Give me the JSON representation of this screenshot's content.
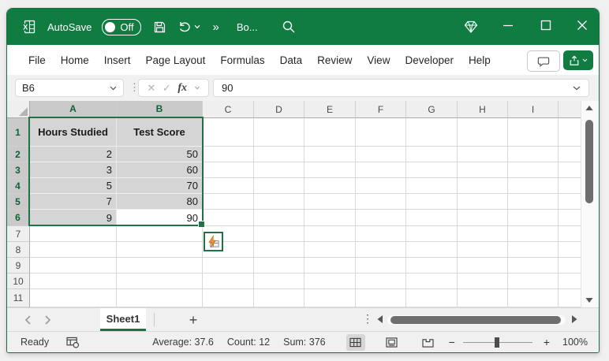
{
  "titlebar": {
    "autosave_label": "AutoSave",
    "autosave_state": "Off",
    "overflow_glyph": "»",
    "doc_name": "Bo..."
  },
  "menubar": {
    "items": [
      "File",
      "Home",
      "Insert",
      "Page Layout",
      "Formulas",
      "Data",
      "Review",
      "View",
      "Developer",
      "Help"
    ]
  },
  "formula_bar": {
    "name_box_value": "B6",
    "cancel_glyph": "✕",
    "enter_glyph": "✓",
    "fx_label": "fx",
    "input_value": "90"
  },
  "grid": {
    "column_labels": [
      "A",
      "B",
      "C",
      "D",
      "E",
      "F",
      "G",
      "H",
      "I",
      ""
    ],
    "row_labels": [
      "1",
      "2",
      "3",
      "4",
      "5",
      "6",
      "7",
      "8",
      "9",
      "10",
      "11"
    ],
    "selected_columns": [
      "A",
      "B"
    ],
    "selected_rows": [
      "1",
      "2",
      "3",
      "4",
      "5",
      "6"
    ],
    "active_cell": "B6"
  },
  "table": {
    "headers": [
      "Hours Studied",
      "Test Score"
    ],
    "rows": [
      [
        "2",
        "50"
      ],
      [
        "3",
        "60"
      ],
      [
        "5",
        "70"
      ],
      [
        "7",
        "80"
      ],
      [
        "9",
        "90"
      ]
    ]
  },
  "sheet_tabs": {
    "active": "Sheet1",
    "add_label": "+",
    "dots_glyph": "⋮"
  },
  "status_bar": {
    "mode": "Ready",
    "average": "Average: 37.6",
    "count": "Count: 12",
    "sum": "Sum: 376",
    "zoom_minus": "−",
    "zoom_plus": "+",
    "zoom_level": "100%"
  },
  "colors": {
    "titlebar_green": "#107C41",
    "selection_border": "#217346",
    "selection_fill": "#D5D5D5",
    "lightning_orange": "#E8932E"
  }
}
